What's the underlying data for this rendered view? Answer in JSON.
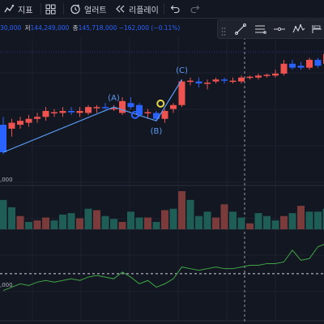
{
  "toolbar": {
    "indicators_label": "지표",
    "alerts_label": "얼러트",
    "replay_label": "리플레이",
    "icons": [
      "indicators-icon",
      "layout-grid-icon",
      "alert-clock-icon",
      "replay-icon",
      "undo-icon",
      "redo-icon"
    ]
  },
  "infobar": {
    "open_partial": "30,000",
    "low_label": "저",
    "low_value": "144,249,000",
    "close_label": "종",
    "close_value": "145,718,000",
    "change_text": "−162,000 (−0.11%)"
  },
  "drawing_tools": [
    "grip-handle-icon",
    "trend-line-icon",
    "parallel-channel-icon",
    "horizontal-ray-icon",
    "pattern-icon",
    "long-short-icon"
  ],
  "colors": {
    "background": "#131722",
    "up": "#ef5350",
    "down": "#2962ff",
    "vol_up": "#7c3b3b",
    "vol_down": "#1e5e56",
    "wave_line": "#5b9cf6",
    "osc_line": "#3fa546",
    "level_line": "#d1d4dc",
    "grid": "#1e222d",
    "crosshair": "#9598a1",
    "marker_yellow": "#e5d94a",
    "marker_blue": "#2962ff"
  },
  "chart_data": {
    "type": "candlestick",
    "candles": [
      {
        "o": 1438,
        "h": 1442,
        "l": 1423,
        "c": 1424
      },
      {
        "o": 1436,
        "h": 1441,
        "l": 1432,
        "c": 1439
      },
      {
        "o": 1438,
        "h": 1442,
        "l": 1436,
        "c": 1440
      },
      {
        "o": 1439,
        "h": 1443,
        "l": 1437,
        "c": 1441
      },
      {
        "o": 1441,
        "h": 1444,
        "l": 1439,
        "c": 1442
      },
      {
        "o": 1442,
        "h": 1447,
        "l": 1440,
        "c": 1445
      },
      {
        "o": 1444,
        "h": 1446,
        "l": 1442,
        "c": 1444.4
      },
      {
        "o": 1444,
        "h": 1447,
        "l": 1442,
        "c": 1445
      },
      {
        "o": 1445,
        "h": 1447,
        "l": 1443,
        "c": 1444.3
      },
      {
        "o": 1444,
        "h": 1447,
        "l": 1442,
        "c": 1445
      },
      {
        "o": 1444,
        "h": 1448,
        "l": 1443,
        "c": 1447
      },
      {
        "o": 1447,
        "h": 1448,
        "l": 1444,
        "c": 1447
      },
      {
        "o": 1447,
        "h": 1449,
        "l": 1446,
        "c": 1446.4
      },
      {
        "o": 1446,
        "h": 1448,
        "l": 1445,
        "c": 1446.4
      },
      {
        "o": 1444,
        "h": 1452,
        "l": 1443,
        "c": 1450
      },
      {
        "o": 1449,
        "h": 1452,
        "l": 1446,
        "c": 1447
      },
      {
        "o": 1448,
        "h": 1449,
        "l": 1442,
        "c": 1443
      },
      {
        "o": 1444,
        "h": 1446,
        "l": 1441,
        "c": 1444.4
      },
      {
        "o": 1444,
        "h": 1445,
        "l": 1440,
        "c": 1441
      },
      {
        "o": 1441,
        "h": 1446,
        "l": 1439,
        "c": 1445
      },
      {
        "o": 1446,
        "h": 1449,
        "l": 1444,
        "c": 1448
      },
      {
        "o": 1448,
        "h": 1461,
        "l": 1447,
        "c": 1460
      },
      {
        "o": 1460,
        "h": 1462,
        "l": 1458,
        "c": 1460.4
      },
      {
        "o": 1460,
        "h": 1462,
        "l": 1457,
        "c": 1459
      },
      {
        "o": 1459,
        "h": 1461,
        "l": 1456,
        "c": 1459.4
      },
      {
        "o": 1460,
        "h": 1462,
        "l": 1459,
        "c": 1461
      },
      {
        "o": 1461,
        "h": 1462,
        "l": 1459,
        "c": 1460.4
      },
      {
        "o": 1460,
        "h": 1462,
        "l": 1459,
        "c": 1460.4
      },
      {
        "o": 1460,
        "h": 1463,
        "l": 1459,
        "c": 1462
      },
      {
        "o": 1462,
        "h": 1463,
        "l": 1461,
        "c": 1462.4
      },
      {
        "o": 1462,
        "h": 1464,
        "l": 1461,
        "c": 1463
      },
      {
        "o": 1463,
        "h": 1464,
        "l": 1462,
        "c": 1463.4
      },
      {
        "o": 1463,
        "h": 1466,
        "l": 1462,
        "c": 1464
      },
      {
        "o": 1464,
        "h": 1471,
        "l": 1463,
        "c": 1469
      },
      {
        "o": 1469,
        "h": 1471,
        "l": 1466,
        "c": 1467
      },
      {
        "o": 1468,
        "h": 1470,
        "l": 1466,
        "c": 1467
      },
      {
        "o": 1467,
        "h": 1472,
        "l": 1466,
        "c": 1471
      },
      {
        "o": 1471,
        "h": 1472,
        "l": 1467,
        "c": 1468
      },
      {
        "o": 1469,
        "h": 1474,
        "l": 1468,
        "c": 1474
      }
    ],
    "volume": [
      {
        "v": 40,
        "up": false
      },
      {
        "v": 30,
        "up": false
      },
      {
        "v": 18,
        "up": true
      },
      {
        "v": 10,
        "up": false
      },
      {
        "v": 12,
        "up": true
      },
      {
        "v": 16,
        "up": true
      },
      {
        "v": 12,
        "up": false
      },
      {
        "v": 20,
        "up": false
      },
      {
        "v": 22,
        "up": false
      },
      {
        "v": 15,
        "up": true
      },
      {
        "v": 28,
        "up": false
      },
      {
        "v": 26,
        "up": true
      },
      {
        "v": 18,
        "up": false
      },
      {
        "v": 14,
        "up": false
      },
      {
        "v": 10,
        "up": true
      },
      {
        "v": 24,
        "up": false
      },
      {
        "v": 16,
        "up": false
      },
      {
        "v": 16,
        "up": true
      },
      {
        "v": 10,
        "up": false
      },
      {
        "v": 26,
        "up": true
      },
      {
        "v": 28,
        "up": false
      },
      {
        "v": 52,
        "up": true
      },
      {
        "v": 40,
        "up": false
      },
      {
        "v": 18,
        "up": false
      },
      {
        "v": 24,
        "up": false
      },
      {
        "v": 16,
        "up": true
      },
      {
        "v": 34,
        "up": true
      },
      {
        "v": 24,
        "up": false
      },
      {
        "v": 16,
        "up": false
      },
      {
        "v": 8,
        "up": true
      },
      {
        "v": 22,
        "up": false
      },
      {
        "v": 18,
        "up": false
      },
      {
        "v": 12,
        "up": false
      },
      {
        "v": 18,
        "up": true
      },
      {
        "v": 22,
        "up": false
      },
      {
        "v": 32,
        "up": true
      },
      {
        "v": 24,
        "up": false
      },
      {
        "v": 24,
        "up": false
      },
      {
        "v": 28,
        "up": false
      }
    ],
    "oscillator": [
      46,
      48,
      50,
      49,
      51,
      52,
      51,
      52,
      53,
      52,
      54,
      55,
      54,
      53,
      57,
      54,
      50,
      52,
      48,
      50,
      53,
      60,
      59,
      58,
      59,
      60,
      59,
      59,
      60,
      61,
      61,
      62,
      62,
      63,
      70,
      64,
      65,
      72,
      74
    ],
    "osc_level": 56,
    "wave_points": [
      {
        "i": 0,
        "price": 1424,
        "label": ""
      },
      {
        "i": 13,
        "price": 1447,
        "label": "(A)"
      },
      {
        "i": 18,
        "price": 1440,
        "label": "(B)"
      },
      {
        "i": 21,
        "price": 1461,
        "label": "(C)"
      }
    ],
    "markers": [
      {
        "i": 18.5,
        "price": 1443,
        "kind": "yellow"
      },
      {
        "i": 15.5,
        "price": 1443,
        "kind": "blue"
      }
    ],
    "y_tick_labels": [
      ",000",
      ",000"
    ],
    "price_range": [
      1410,
      1480
    ]
  }
}
